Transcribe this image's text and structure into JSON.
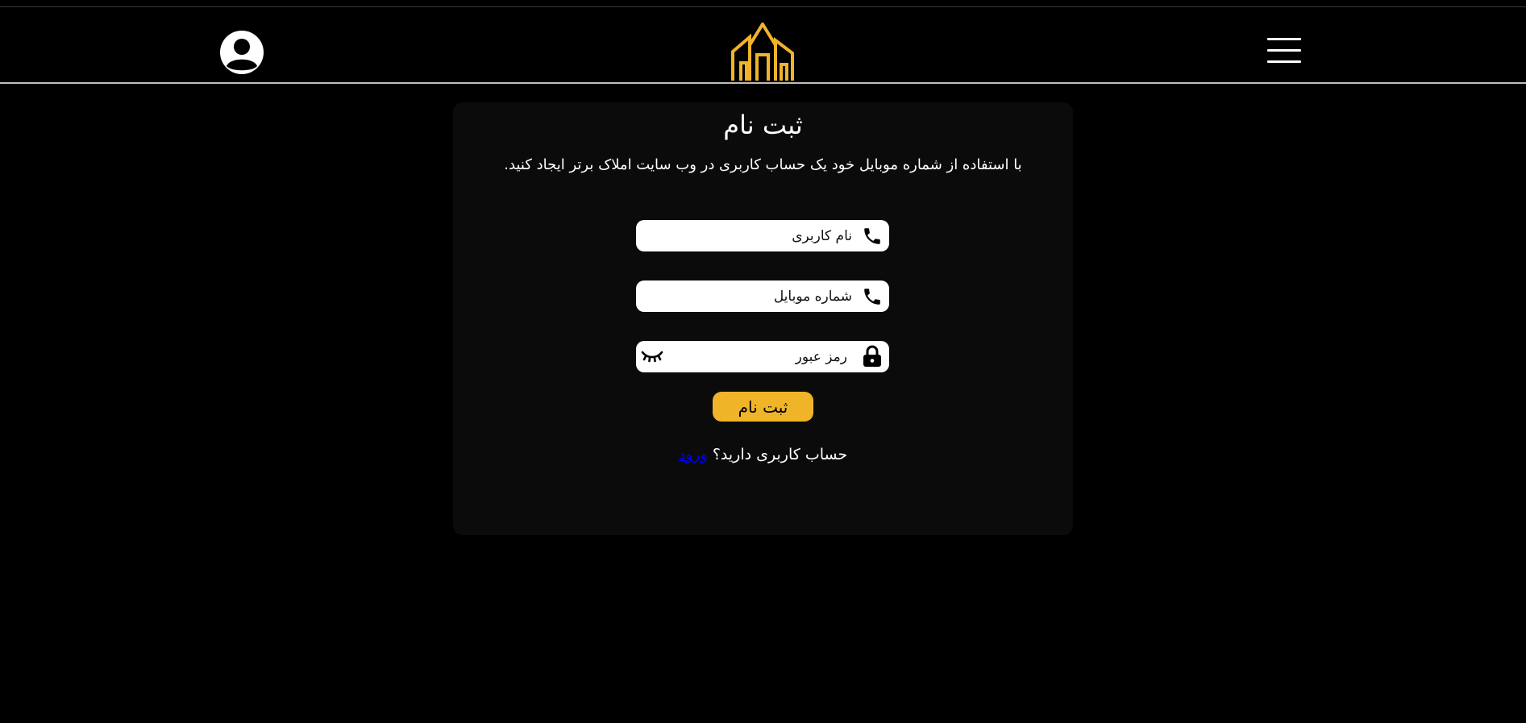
{
  "header": {
    "avatar_icon": "user-avatar-icon",
    "logo_icon": "building-logo-icon",
    "menu_icon": "hamburger-menu-icon",
    "logo_color": "#f0b429"
  },
  "form": {
    "title": "ثبت نام",
    "subtitle": "با استفاده از شماره موبایل خود یک حساب کاربری در وب سایت املاک برتر ایجاد کنید.",
    "username": {
      "placeholder": "نام کاربری",
      "value": "",
      "icon": "phone-icon"
    },
    "mobile": {
      "placeholder": "شماره موبایل",
      "value": "",
      "icon": "phone-icon"
    },
    "password": {
      "placeholder": "رمز عبور",
      "value": "",
      "icon": "lock-icon",
      "toggle_icon": "eye-closed-icon"
    },
    "submit_label": "ثبت نام",
    "have_account_text": "حساب کاربری دارید؟",
    "login_link": "ورود",
    "accent_color": "#f0b429"
  }
}
